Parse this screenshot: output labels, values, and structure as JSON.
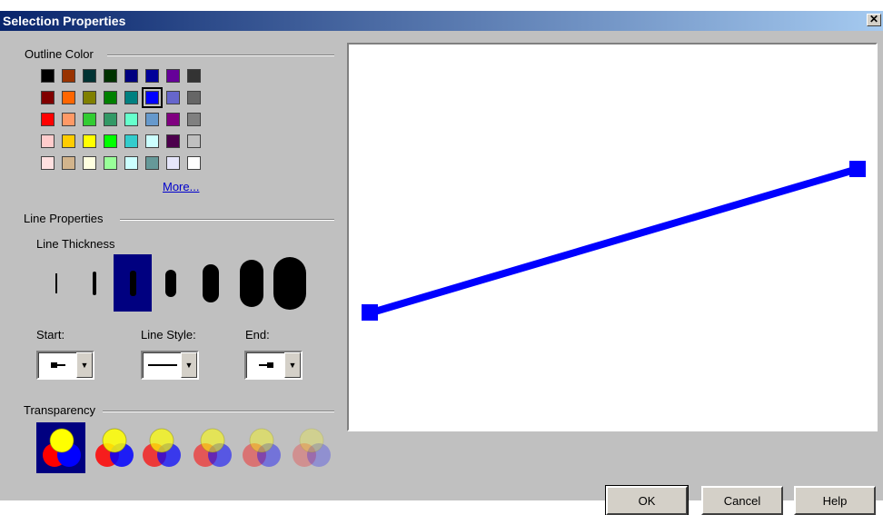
{
  "window": {
    "title": "Selection Properties",
    "close_glyph": "✕"
  },
  "outline_color": {
    "label": "Outline Color",
    "more_label": "More...",
    "selected_color": "#0000ff",
    "swatches": [
      [
        "#000000",
        "#993300",
        "#003333",
        "#003300",
        "#000080",
        "#000099",
        "#660099",
        "#333333"
      ],
      [
        "#800000",
        "#ff6600",
        "#808000",
        "#008000",
        "#008080",
        "#0000ff",
        "#6666cc",
        "#666666"
      ],
      [
        "#ff0000",
        "#ff9966",
        "#33cc33",
        "#339966",
        "#66ffcc",
        "#6699cc",
        "#800080",
        "#808080"
      ],
      [
        "#ffcccc",
        "#ffcc00",
        "#ffff00",
        "#00ff00",
        "#33cccc",
        "#ccffff",
        "#4d004d",
        "#c0c0c0"
      ],
      [
        "#ffe0e0",
        "#d2b48c",
        "#ffffe0",
        "#99ff99",
        "#ccffff",
        "#669999",
        "#e6e6fa",
        "#ffffff"
      ]
    ]
  },
  "line_properties": {
    "label": "Line Properties",
    "thickness_label": "Line Thickness",
    "selected_thickness_index": 2,
    "start_label": "Start:",
    "style_label": "Line Style:",
    "end_label": "End:"
  },
  "transparency": {
    "label": "Transparency",
    "selected_index": 0
  },
  "preview": {
    "line_color": "#0000ff"
  },
  "buttons": {
    "ok": "OK",
    "cancel": "Cancel",
    "help": "Help"
  }
}
